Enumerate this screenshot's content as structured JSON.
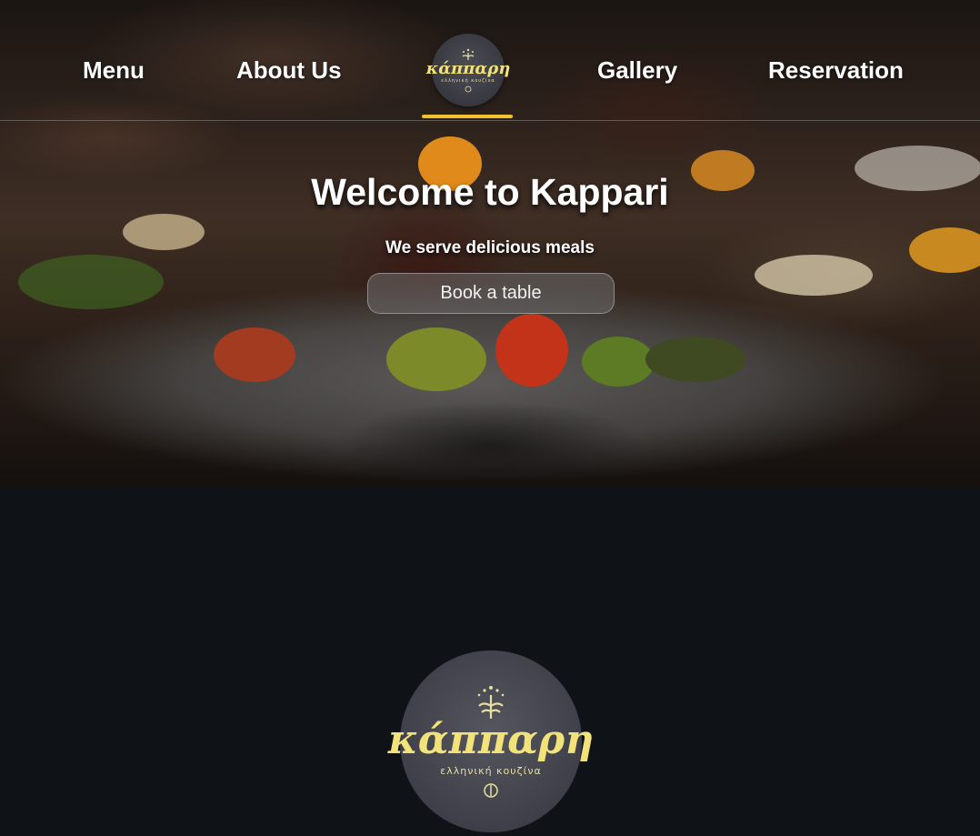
{
  "nav": {
    "items": [
      {
        "label": "Menu"
      },
      {
        "label": "About Us"
      },
      {
        "label": "Gallery"
      },
      {
        "label": "Reservation"
      }
    ],
    "active_color": "#f2c12e"
  },
  "logo": {
    "name": "κάππαρη",
    "tagline": "ελληνική κουζίνα",
    "icon": "leaf-sprig-icon",
    "text_color": "#f2e27a"
  },
  "hero": {
    "title": "Welcome to Kappari",
    "subtitle": "We serve delicious meals",
    "cta_label": "Book a table"
  },
  "colors": {
    "background": "#0f1217",
    "accent": "#f2c12e"
  }
}
